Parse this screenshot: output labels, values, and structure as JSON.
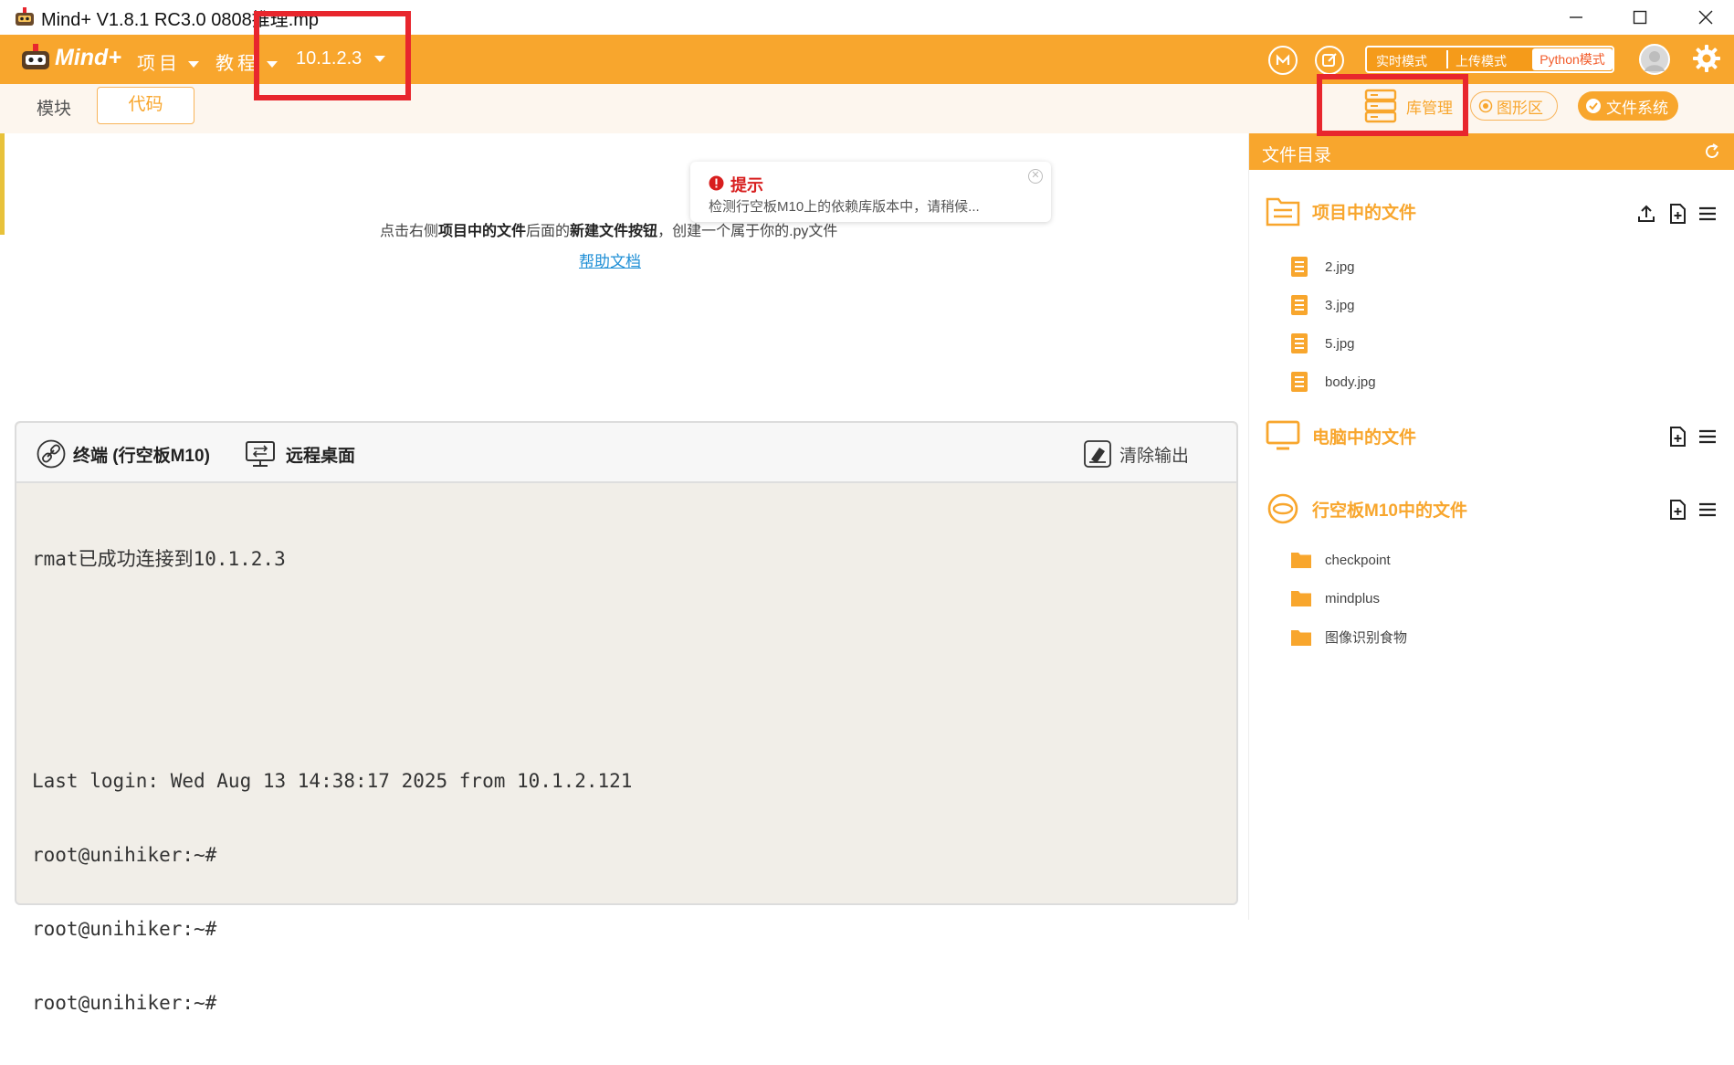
{
  "window": {
    "title": "Mind+ V1.8.1 RC3.0   0808推理.mp"
  },
  "menubar": {
    "logo_text": "Mind+",
    "menu_project": "项目",
    "menu_tutorial": "教程",
    "device_ip": "10.1.2.3"
  },
  "modes": {
    "realtime": "实时模式",
    "upload": "上传模式",
    "python": "Python模式",
    "active": "Python模式"
  },
  "subbar": {
    "tab_blocks": "模块",
    "tab_code": "代码",
    "library": "库管理",
    "graphics": "图形区",
    "filesystem": "文件系统"
  },
  "editor": {
    "hint_part1": "点击右侧",
    "hint_bold1": "项目中的文件",
    "hint_part2": "后面的",
    "hint_bold2": "新建文件按钮",
    "hint_part3": "，创建一个属于你的.py文件",
    "help_link": "帮助文档"
  },
  "toast": {
    "title": "提示",
    "message": "检测行空板M10上的依赖库版本中，请稍候..."
  },
  "terminal": {
    "tab_terminal": "终端 (行空板M10)",
    "tab_remote": "远程桌面",
    "clear_output": "清除输出",
    "lines": [
      "rmat已成功连接到10.1.2.3",
      "",
      "",
      "Last login: Wed Aug 13 14:38:17 2025 from 10.1.2.121",
      "root@unihiker:~#",
      "root@unihiker:~#",
      "root@unihiker:~#"
    ]
  },
  "filepanel": {
    "header": "文件目录",
    "section_project": "项目中的文件",
    "project_files": [
      "2.jpg",
      "3.jpg",
      "5.jpg",
      "body.jpg"
    ],
    "section_computer": "电脑中的文件",
    "section_board": "行空板M10中的文件",
    "board_folders": [
      "checkpoint",
      "mindplus",
      "图像识别食物"
    ]
  },
  "colors": {
    "brand_orange": "#f8a62d",
    "annotation_red": "#e8262d",
    "toast_red": "#d81e1e",
    "link_blue": "#1f8fd6"
  }
}
